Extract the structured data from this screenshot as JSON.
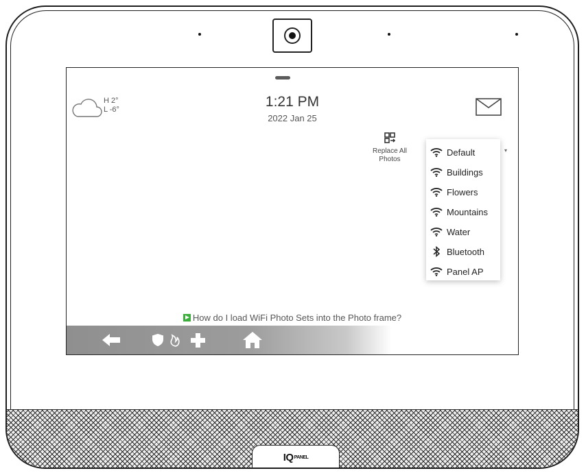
{
  "device": {
    "brand": "IQ",
    "brand_suffix": "PANEL"
  },
  "weather": {
    "high": "H 2°",
    "low": "L -6°",
    "icon": "cloud-icon"
  },
  "clock": {
    "time": "1:21 PM",
    "date": "2022 Jan 25"
  },
  "mail": {
    "icon": "envelope-icon"
  },
  "replace_all": {
    "label": "Replace All Photos",
    "icon": "replace-photos-icon"
  },
  "photo_sets": {
    "items": [
      {
        "label": "Default",
        "icon": "wifi-icon"
      },
      {
        "label": "Buildings",
        "icon": "wifi-icon"
      },
      {
        "label": "Flowers",
        "icon": "wifi-icon"
      },
      {
        "label": "Mountains",
        "icon": "wifi-icon"
      },
      {
        "label": "Water",
        "icon": "wifi-icon"
      },
      {
        "label": "Bluetooth",
        "icon": "bluetooth-icon"
      },
      {
        "label": "Panel AP",
        "icon": "wifi-icon"
      }
    ]
  },
  "help": {
    "text": "How do I load WiFi Photo Sets into the Photo frame?"
  },
  "navbar": {
    "back_icon": "back-arrow-icon",
    "emergency_icon": "emergency-icons",
    "home_icon": "home-icon"
  },
  "colors": {
    "help_play": "#3cae3c",
    "navbar": "#9a9a9a"
  }
}
